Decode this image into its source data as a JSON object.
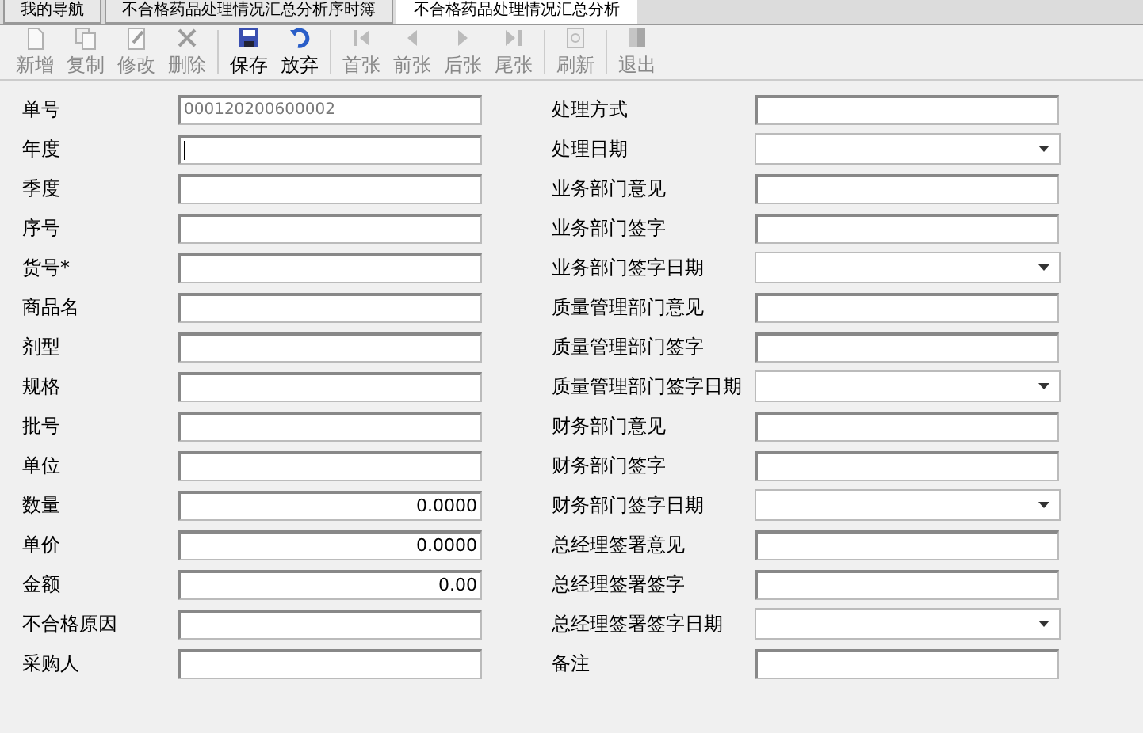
{
  "tabs": [
    {
      "label": "我的导航",
      "selected": false
    },
    {
      "label": "不合格药品处理情况汇总分析序时簿",
      "selected": false
    },
    {
      "label": "不合格药品处理情况汇总分析",
      "selected": true
    }
  ],
  "toolbar": [
    {
      "kind": "button",
      "label": "新增",
      "disabled": true
    },
    {
      "kind": "button",
      "label": "复制",
      "disabled": true
    },
    {
      "kind": "button",
      "label": "修改",
      "disabled": true
    },
    {
      "kind": "button",
      "label": "删除",
      "disabled": true
    },
    {
      "kind": "separator"
    },
    {
      "kind": "button",
      "label": "保存",
      "disabled": false
    },
    {
      "kind": "button",
      "label": "放弃",
      "disabled": false
    },
    {
      "kind": "separator"
    },
    {
      "kind": "button",
      "label": "首张",
      "disabled": true
    },
    {
      "kind": "button",
      "label": "前张",
      "disabled": true
    },
    {
      "kind": "button",
      "label": "后张",
      "disabled": true
    },
    {
      "kind": "button",
      "label": "尾张",
      "disabled": true
    },
    {
      "kind": "separator"
    },
    {
      "kind": "button",
      "label": "刷新",
      "disabled": true
    },
    {
      "kind": "separator"
    },
    {
      "kind": "button",
      "label": "退出",
      "disabled": true
    }
  ],
  "left_fields": [
    {
      "label": "单号",
      "kind": "text",
      "value": "000120200600002",
      "disabled": true
    },
    {
      "label": "年度",
      "kind": "text",
      "focused": true
    },
    {
      "label": "季度",
      "kind": "text"
    },
    {
      "label": "序号",
      "kind": "text"
    },
    {
      "label": "货号*",
      "kind": "text"
    },
    {
      "label": "商品名",
      "kind": "text"
    },
    {
      "label": "剂型",
      "kind": "text"
    },
    {
      "label": "规格",
      "kind": "text"
    },
    {
      "label": "批号",
      "kind": "text"
    },
    {
      "label": "单位",
      "kind": "text"
    },
    {
      "label": "数量",
      "kind": "number",
      "value": "0.0000"
    },
    {
      "label": "单价",
      "kind": "number",
      "value": "0.0000"
    },
    {
      "label": "金额",
      "kind": "number",
      "value": "0.00"
    },
    {
      "label": "不合格原因",
      "kind": "text"
    },
    {
      "label": "采购人",
      "kind": "text"
    }
  ],
  "right_fields": [
    {
      "label": "处理方式",
      "kind": "text"
    },
    {
      "label": "处理日期",
      "kind": "dropdown"
    },
    {
      "label": "业务部门意见",
      "kind": "text"
    },
    {
      "label": "业务部门签字",
      "kind": "text"
    },
    {
      "label": "业务部门签字日期",
      "kind": "dropdown"
    },
    {
      "label": "质量管理部门意见",
      "kind": "text"
    },
    {
      "label": "质量管理部门签字",
      "kind": "text"
    },
    {
      "label": "质量管理部门签字日期",
      "kind": "dropdown"
    },
    {
      "label": "财务部门意见",
      "kind": "text"
    },
    {
      "label": "财务部门签字",
      "kind": "text"
    },
    {
      "label": "财务部门签字日期",
      "kind": "dropdown"
    },
    {
      "label": "总经理签署意见",
      "kind": "text"
    },
    {
      "label": "总经理签署签字",
      "kind": "text"
    },
    {
      "label": "总经理签署签字日期",
      "kind": "dropdown"
    },
    {
      "label": "备注",
      "kind": "text"
    }
  ]
}
